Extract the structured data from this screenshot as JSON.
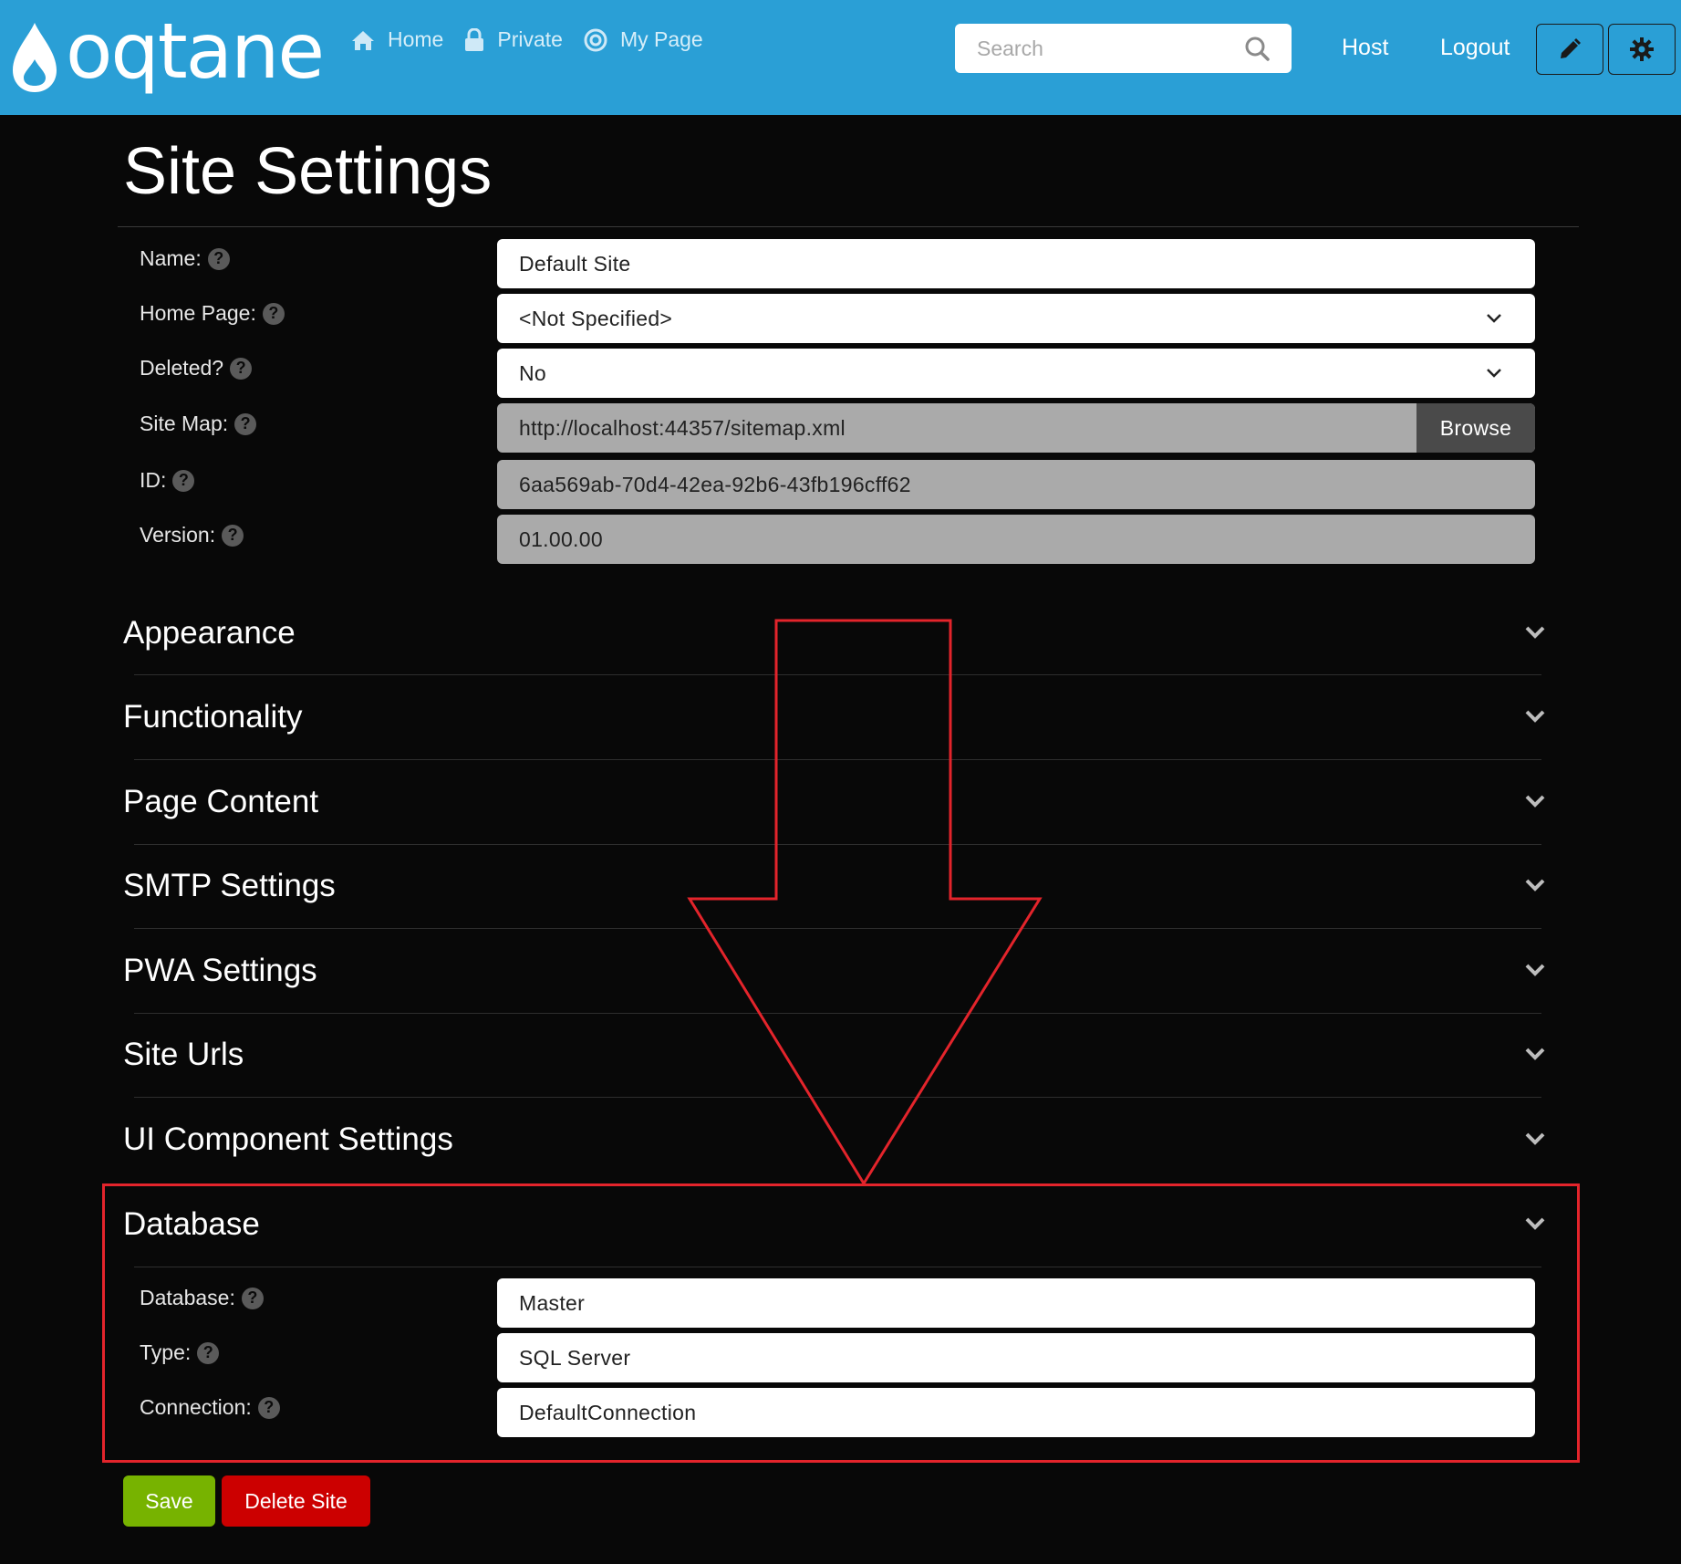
{
  "header": {
    "logo_text": "oqtane",
    "nav": [
      {
        "label": "Home",
        "icon": "home-icon"
      },
      {
        "label": "Private",
        "icon": "lock-icon"
      },
      {
        "label": "My Page",
        "icon": "target-icon"
      }
    ],
    "search_placeholder": "Search",
    "host_label": "Host",
    "logout_label": "Logout",
    "edit_icon": "pencil-icon",
    "settings_icon": "gear-icon"
  },
  "page": {
    "title": "Site Settings"
  },
  "fields": [
    {
      "label": "Name:",
      "value": "Default Site",
      "kind": "text"
    },
    {
      "label": "Home Page:",
      "value": "<Not Specified>",
      "kind": "select"
    },
    {
      "label": "Deleted?",
      "value": "No",
      "kind": "select"
    },
    {
      "label": "Site Map:",
      "value": "http://localhost:44357/sitemap.xml",
      "kind": "readonly",
      "button": "Browse"
    },
    {
      "label": "ID:",
      "value": "6aa569ab-70d4-42ea-92b6-43fb196cff62",
      "kind": "readonly"
    },
    {
      "label": "Version:",
      "value": "01.00.00",
      "kind": "readonly"
    }
  ],
  "sections": [
    {
      "title": "Appearance"
    },
    {
      "title": "Functionality"
    },
    {
      "title": "Page Content"
    },
    {
      "title": "SMTP Settings"
    },
    {
      "title": "PWA Settings"
    },
    {
      "title": "Site Urls"
    },
    {
      "title": "UI Component Settings"
    },
    {
      "title": "Database"
    }
  ],
  "database": {
    "fields": [
      {
        "label": "Database:",
        "value": "Master"
      },
      {
        "label": "Type:",
        "value": "SQL Server"
      },
      {
        "label": "Connection:",
        "value": "DefaultConnection"
      }
    ]
  },
  "buttons": {
    "save": "Save",
    "delete": "Delete Site"
  },
  "help_glyph": "?",
  "colors": {
    "header_bg": "#2a9fd6",
    "page_bg": "#080808",
    "annotation": "#e3242b",
    "save": "#77b300",
    "delete": "#cc0000"
  }
}
